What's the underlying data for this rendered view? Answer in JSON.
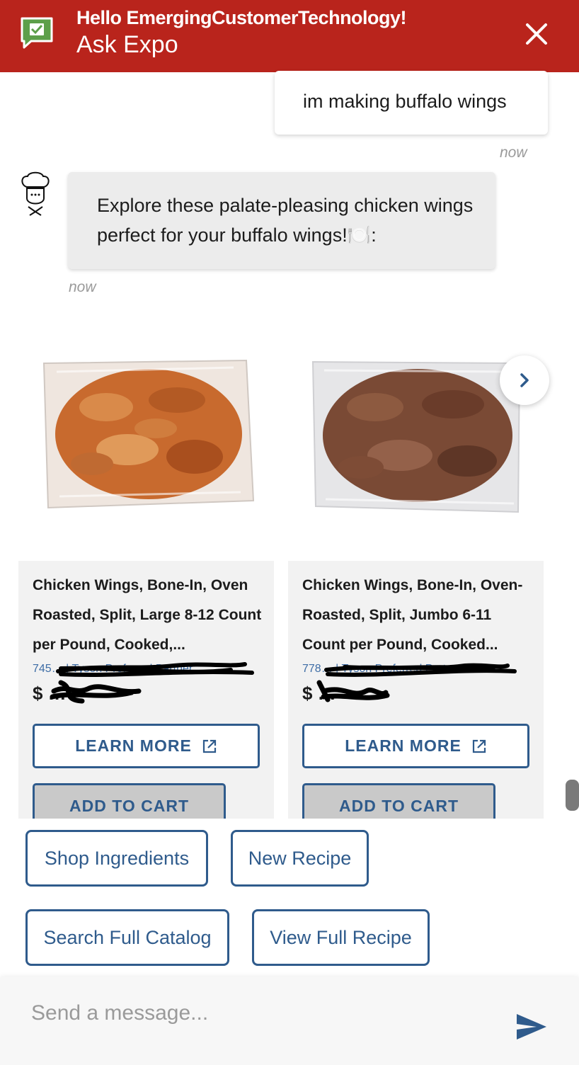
{
  "header": {
    "greeting": "Hello EmergingCustomerTechnology!",
    "title": "Ask Expo",
    "logo_icon": "chat-check-icon",
    "close_icon": "close-icon"
  },
  "messages": {
    "user": {
      "text": "im making buffalo wings",
      "timestamp": "now"
    },
    "bot": {
      "text": "Explore these palate-pleasing chicken wings perfect for your buffalo wings!🍽️:",
      "timestamp": "now",
      "avatar_icon": "chef-icon"
    }
  },
  "products": [
    {
      "title": "Chicken Wings, Bone-In, Oven Roasted, Split, Large 8-12 Count per Pound, Cooked,...",
      "sku": "745… | Tyson Preferred Partner",
      "price": "$ …",
      "learn_more_label": "LEARN MORE",
      "add_to_cart_label": "ADD TO CART",
      "image_color": "#c86a2e"
    },
    {
      "title": "Chicken Wings, Bone-In, Oven-Roasted, Split, Jumbo 6-11 Count per Pound, Cooked...",
      "sku": "778… | Tyson Preferred Partner",
      "price": "$ …",
      "learn_more_label": "LEARN MORE",
      "add_to_cart_label": "ADD TO CART",
      "image_color": "#7a4a35"
    }
  ],
  "carousel": {
    "next_icon": "chevron-right-icon"
  },
  "suggestions": [
    "Shop Ingredients",
    "New Recipe",
    "Search Full Catalog",
    "View Full Recipe"
  ],
  "composer": {
    "placeholder": "Send a message...",
    "send_icon": "send-icon"
  },
  "colors": {
    "brand_red": "#b9241c",
    "accent_blue": "#2f5b8c",
    "link_blue": "#3e6da6"
  }
}
